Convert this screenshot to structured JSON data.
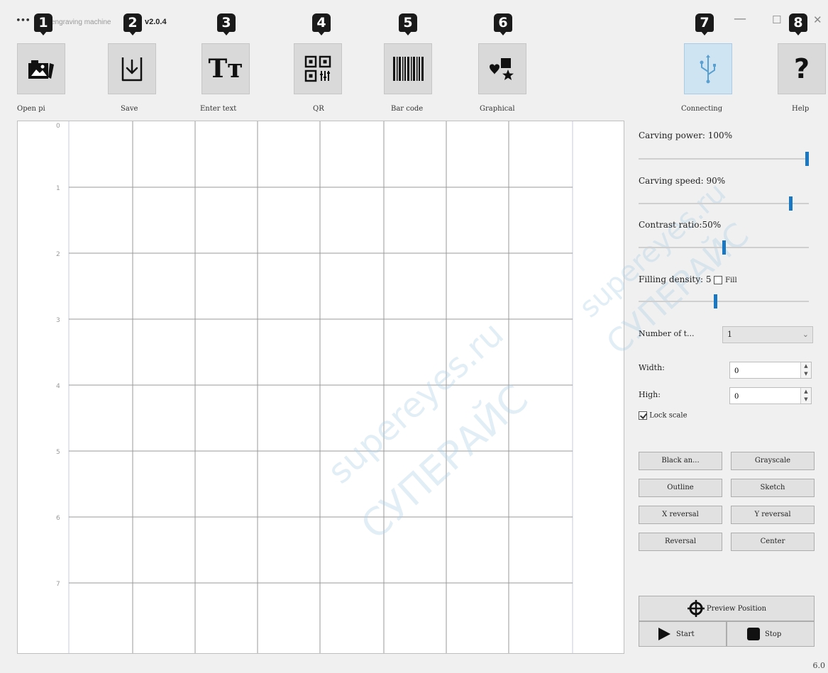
{
  "window": {
    "menu_glyph": "•••",
    "title": "engraving machine",
    "version": "v2.0.4",
    "minimize_glyph": "—",
    "maximize_glyph": "☐",
    "close_glyph": "✕"
  },
  "markers": [
    "1",
    "2",
    "3",
    "4",
    "5",
    "6",
    "7",
    "8"
  ],
  "toolbar": {
    "open_picture": "Open pi",
    "save": "Save",
    "enter_text": "Enter text",
    "qr": "QR",
    "bar_code": "Bar code",
    "graphical": "Graphical",
    "connecting": "Connecting",
    "help": "Help",
    "text_icon_glyph": "Tт",
    "help_glyph": "?"
  },
  "canvas": {
    "y_ticks": [
      "0",
      "1",
      "2",
      "3",
      "4",
      "5",
      "6",
      "7"
    ]
  },
  "settings": {
    "carving_power": {
      "label": "Carving power: 100%",
      "value": 100
    },
    "carving_speed": {
      "label": "Carving speed: 90%",
      "value": 90
    },
    "contrast_ratio": {
      "label": "Contrast ratio:50%",
      "value": 50
    },
    "filling_density": {
      "label": "Filling density: 5",
      "value_fraction": 0.45,
      "fill_label": "Fill",
      "fill_checked": false
    },
    "number_of_times": {
      "label": "Number of t...",
      "value": "1"
    },
    "width": {
      "label": "Width:",
      "value": "0"
    },
    "high": {
      "label": "High:",
      "value": "0"
    },
    "lock_scale": {
      "label": "Lock scale",
      "checked": true
    }
  },
  "modes": {
    "black_white": "Black an...",
    "grayscale": "Grayscale",
    "outline": "Outline",
    "sketch": "Sketch",
    "x_reversal": "X reversal",
    "y_reversal": "Y reversal",
    "reversal": "Reversal",
    "center": "Center"
  },
  "actions": {
    "preview_position": "Preview Position",
    "start": "Start",
    "stop": "Stop"
  },
  "footer": {
    "version_short": "6.0"
  },
  "watermark": {
    "latin": "supereyes.ru",
    "cyrillic": "СУПЕРАЙС"
  },
  "colors": {
    "accent": "#1a78c2",
    "usb": "#5aa0d0",
    "grid": "#9a9a9a"
  }
}
